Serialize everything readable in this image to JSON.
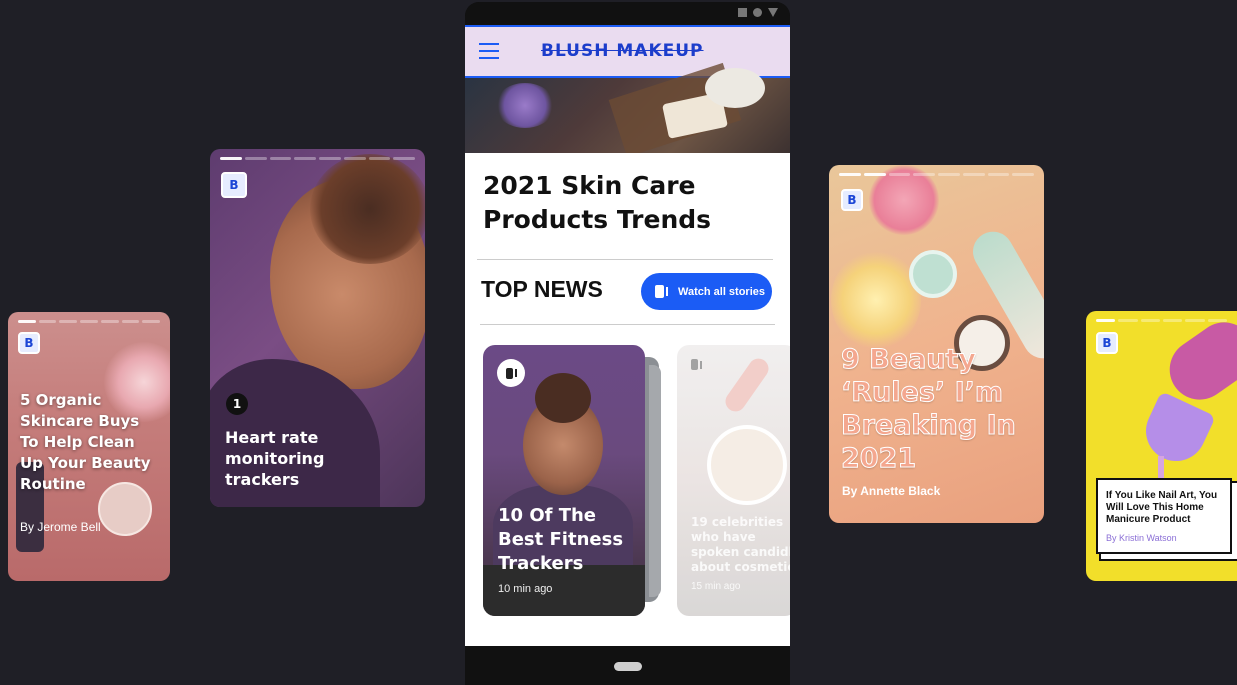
{
  "stories": {
    "s1": {
      "badge": "B",
      "title": "5 Organic Skincare Buys To Help Clean Up Your Beauty Routine",
      "byline": "By Jerome Bell"
    },
    "s2": {
      "badge": "B",
      "number": "1",
      "title": "Heart rate monitoring trackers"
    },
    "s4": {
      "badge": "B",
      "title": "9 Beauty ‘Rules’ I’m Breaking In 2021",
      "byline": "By Annette Black"
    },
    "s5": {
      "badge": "B",
      "title": "If You Like Nail Art, You Will Love This  Home Manicure Product",
      "byline": "By Kristin Watson"
    }
  },
  "phone": {
    "brand": "BLUSH MAKEUP",
    "article_title": "2021 Skin Care Products Trends",
    "section_title": "TOP NEWS",
    "watch_button": "Watch all stories",
    "cards": [
      {
        "title": "10 Of The Best Fitness Trackers",
        "time": "10 min ago"
      },
      {
        "title": "19 celebrities who have spoken candidly about cosmetic",
        "time": "15 min ago"
      }
    ]
  },
  "colors": {
    "accent": "#1b5cf5",
    "background": "#1f1f26",
    "header_bg": "#eadcf0"
  }
}
